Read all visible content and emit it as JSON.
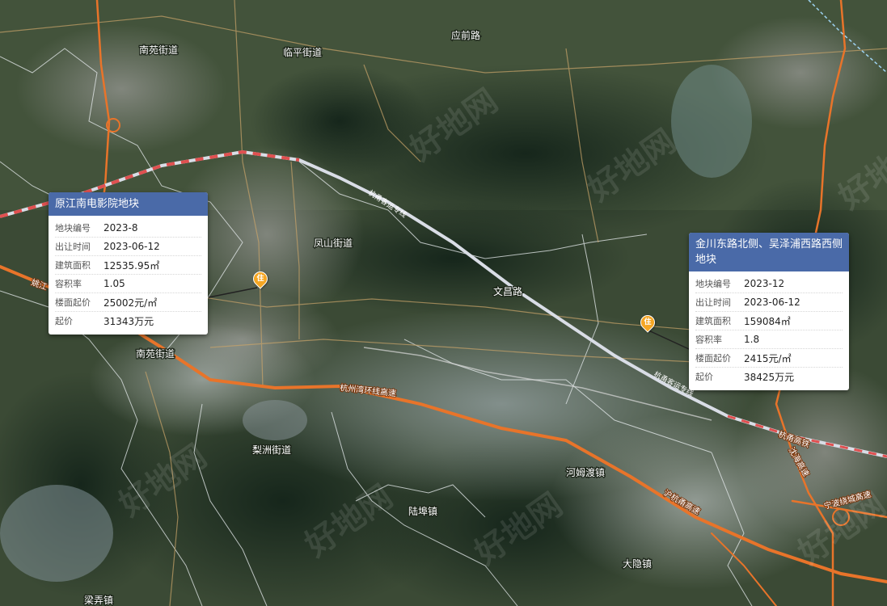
{
  "map": {
    "places": [
      {
        "id": "nanyuan",
        "label": "南苑街道"
      },
      {
        "id": "linping",
        "label": "临平街道"
      },
      {
        "id": "yingshanlu",
        "label": "应前路"
      },
      {
        "id": "fengshan",
        "label": "凤山街道"
      },
      {
        "id": "wenyuan",
        "label": "文昌路"
      },
      {
        "id": "nanshan",
        "label": "南苑街道"
      },
      {
        "id": "lizhou",
        "label": "梨洲街道"
      },
      {
        "id": "hemu",
        "label": "河姆渡镇"
      },
      {
        "id": "lubu",
        "label": "陆埠镇"
      },
      {
        "id": "dayin",
        "label": "大隐镇"
      },
      {
        "id": "liangnong",
        "label": "梁弄镇"
      }
    ],
    "roads": {
      "hangzhouwan": "杭州湾环线高速",
      "huyong": "沪杭甬高速",
      "hangyong_rail": "杭甬高铁",
      "yongbo": "宁波绕城高速",
      "shenhai": "沈海高速",
      "yuyaowest": "姚江",
      "raillbl": "杭甬客运专线"
    },
    "watermark": "好地网",
    "colors": {
      "accent": "#4a6aa8",
      "highway": "#e8742a",
      "pin": "#f5a623",
      "rail": "#d9dde6"
    }
  },
  "cards": [
    {
      "title": "原江南电影院地块",
      "rows": [
        {
          "k": "地块编号",
          "v": "2023-8"
        },
        {
          "k": "出让时间",
          "v": "2023-06-12"
        },
        {
          "k": "建筑面积",
          "v": "12535.95㎡"
        },
        {
          "k": "容积率",
          "v": "1.05"
        },
        {
          "k": "楼面起价",
          "v": "25002元/㎡"
        },
        {
          "k": "起价",
          "v": "31343万元"
        }
      ]
    },
    {
      "title": "金川东路北侧、吴泽浦西路西侧地块",
      "rows": [
        {
          "k": "地块编号",
          "v": "2023-12"
        },
        {
          "k": "出让时间",
          "v": "2023-06-12"
        },
        {
          "k": "建筑面积",
          "v": "159084㎡"
        },
        {
          "k": "容积率",
          "v": "1.8"
        },
        {
          "k": "楼面起价",
          "v": "2415元/㎡"
        },
        {
          "k": "起价",
          "v": "38425万元"
        }
      ]
    }
  ],
  "pins": [
    {
      "label": "住"
    },
    {
      "label": "住"
    }
  ]
}
